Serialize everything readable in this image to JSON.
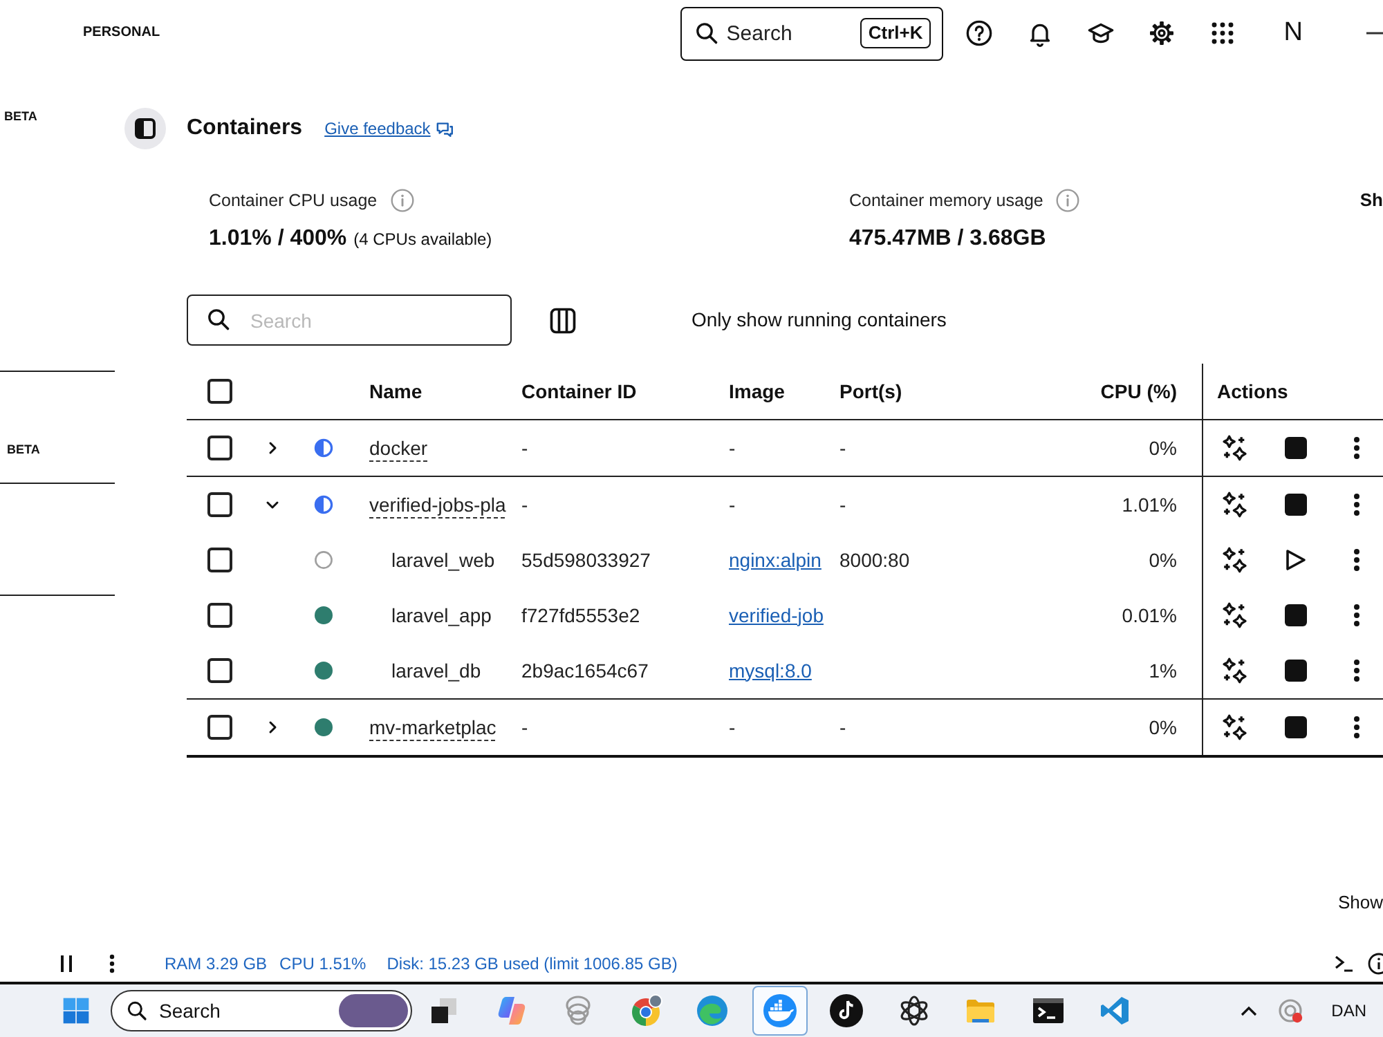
{
  "top_bar": {
    "workspace": "PERSONAL",
    "search": {
      "label": "Search",
      "shortcut": "Ctrl+K"
    },
    "avatar_initial": "N"
  },
  "sidebar": {
    "items": [
      {
        "badge": "BETA"
      },
      {
        "badge": "BETA"
      }
    ]
  },
  "page": {
    "title": "Containers",
    "feedback_link": "Give feedback"
  },
  "stats": [
    {
      "label": "Container CPU usage",
      "value": "1.01% / 400%",
      "note": "(4 CPUs available)"
    },
    {
      "label": "Container memory usage",
      "value": "475.47MB / 3.68GB"
    }
  ],
  "cut_off_button": {
    "label": "Sh"
  },
  "toolbar": {
    "search": {
      "placeholder": "Search"
    },
    "running_filter_label": "Only show running containers"
  },
  "table": {
    "select_all": {
      "checked": false
    },
    "columns": [
      "Name",
      "Container ID",
      "Image",
      "Port(s)",
      "CPU (%)"
    ],
    "actions_header": "Actions",
    "rows": [
      {
        "kind": "partial",
        "name": "docker",
        "container_id": "-",
        "image": "-",
        "ports": "-",
        "cpu": "0%",
        "checked": false,
        "expanded": false
      },
      {
        "kind": "partial",
        "name": "verified-jobs-pla",
        "container_id": "-",
        "image": "-",
        "ports": "-",
        "cpu": "1.01%",
        "checked": false,
        "expanded": true,
        "children": [
          {
            "kind": "exited",
            "name": "laravel_web",
            "container_id": "55d598033927",
            "image": "nginx:alpin",
            "ports": "8000:80",
            "cpu": "0%",
            "checked": false
          },
          {
            "kind": "running",
            "name": "laravel_app",
            "container_id": "f727fd5553e2",
            "image": "verified-job",
            "cpu": "0.01%",
            "checked": false
          },
          {
            "kind": "running",
            "name": "laravel_db",
            "container_id": "2b9ac1654c67",
            "image": "mysql:8.0",
            "cpu": "1%",
            "checked": false
          }
        ]
      },
      {
        "kind": "running",
        "name": "mv-marketplac",
        "container_id": "-",
        "image": "-",
        "ports": "-",
        "cpu": "0%",
        "checked": false,
        "expanded": false
      }
    ]
  },
  "footer_text": "Show",
  "status_bar": {
    "ram": "RAM 3.29 GB",
    "cpu": "CPU 1.51%",
    "disk": "Disk: 15.23 GB used (limit 1006.85 GB)"
  },
  "taskbar": {
    "search": {
      "label": "Search"
    },
    "apps": [
      {
        "kind": "squares",
        "selected": false
      },
      {
        "kind": "slants",
        "selected": false
      },
      {
        "kind": "rings",
        "selected": false
      },
      {
        "kind": "color-wheel",
        "selected": false
      },
      {
        "kind": "wave",
        "selected": false
      },
      {
        "kind": "whale",
        "selected": true
      },
      {
        "kind": "note",
        "selected": false
      },
      {
        "kind": "atom",
        "selected": false
      },
      {
        "kind": "folder",
        "selected": false
      },
      {
        "kind": "terminal",
        "selected": false
      },
      {
        "kind": "ribbon",
        "selected": false
      }
    ],
    "language": "DAN"
  }
}
